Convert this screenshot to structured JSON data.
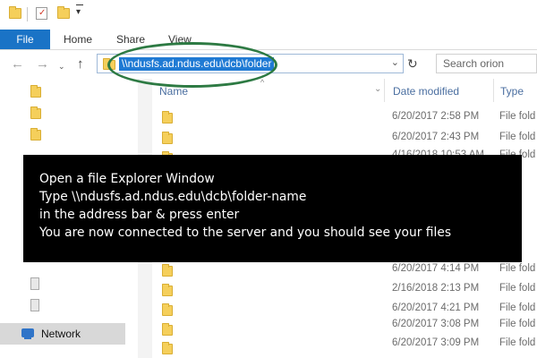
{
  "ribbon": {
    "file": "File",
    "home": "Home",
    "share": "Share",
    "view": "View"
  },
  "address": {
    "path": "\\\\ndusfs.ad.ndus.edu\\dcb\\folder"
  },
  "search": {
    "placeholder": "Search orion"
  },
  "columns": {
    "name": "Name",
    "date": "Date modified",
    "type": "Type"
  },
  "rows": [
    {
      "date": "6/20/2017 2:58 PM",
      "type": "File fold"
    },
    {
      "date": "6/20/2017 2:43 PM",
      "type": "File fold"
    },
    {
      "date": "4/16/2018 10:53 AM",
      "type": "File fold"
    },
    {
      "date": "",
      "type": ""
    },
    {
      "date": "",
      "type": ""
    },
    {
      "date": "",
      "type": ""
    },
    {
      "date": "6/20/2017 4:14 PM",
      "type": "File fold"
    },
    {
      "date": "2/16/2018 2:13 PM",
      "type": "File fold"
    },
    {
      "date": "6/20/2017 4:21 PM",
      "type": "File fold"
    },
    {
      "date": "6/20/2017 3:08 PM",
      "type": "File fold"
    },
    {
      "date": "6/20/2017 3:09 PM",
      "type": "File fold"
    }
  ],
  "nav": {
    "network": "Network"
  },
  "instructions": [
    "Open a file Explorer Window",
    "Type \\\\ndusfs.ad.ndus.edu\\dcb\\folder-name",
    "in the address bar & press enter",
    "You are now connected to the server and you should see your files"
  ],
  "colors": {
    "file_tab": "#1a73c6",
    "annotation": "#2d7a43",
    "overlay": "#000000"
  }
}
